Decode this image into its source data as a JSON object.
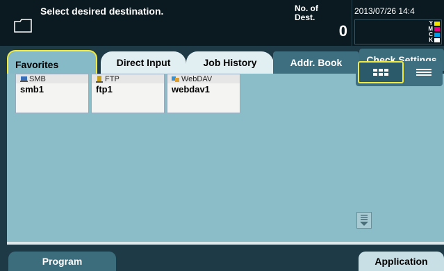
{
  "header": {
    "message": "Select desired destination.",
    "dest_label": "No. of\nDest.",
    "dest_count": "0",
    "datetime": "2013/07/26 14:4",
    "toner": [
      {
        "label": "Y",
        "color": "#f2e600"
      },
      {
        "label": "M",
        "color": "#e6007e"
      },
      {
        "label": "C",
        "color": "#00a0e9"
      },
      {
        "label": "K",
        "color": "#ffffff"
      }
    ]
  },
  "tabs": {
    "favorites": "Favorites",
    "direct_input": "Direct Input",
    "job_history": "Job History",
    "addr_book": "Addr. Book",
    "check_settings": "Check Settings"
  },
  "destinations": [
    {
      "type": "SMB",
      "name": "smb1",
      "icon": "smb-icon"
    },
    {
      "type": "FTP",
      "name": "ftp1",
      "icon": "ftp-icon"
    },
    {
      "type": "WebDAV",
      "name": "webdav1",
      "icon": "webdav-icon"
    }
  ],
  "footer": {
    "program": "Program",
    "application": "Application"
  },
  "colors": {
    "accent_highlight": "#f2ea3c",
    "panel": "#8bbdc9",
    "header_bg": "#0b1a20"
  }
}
